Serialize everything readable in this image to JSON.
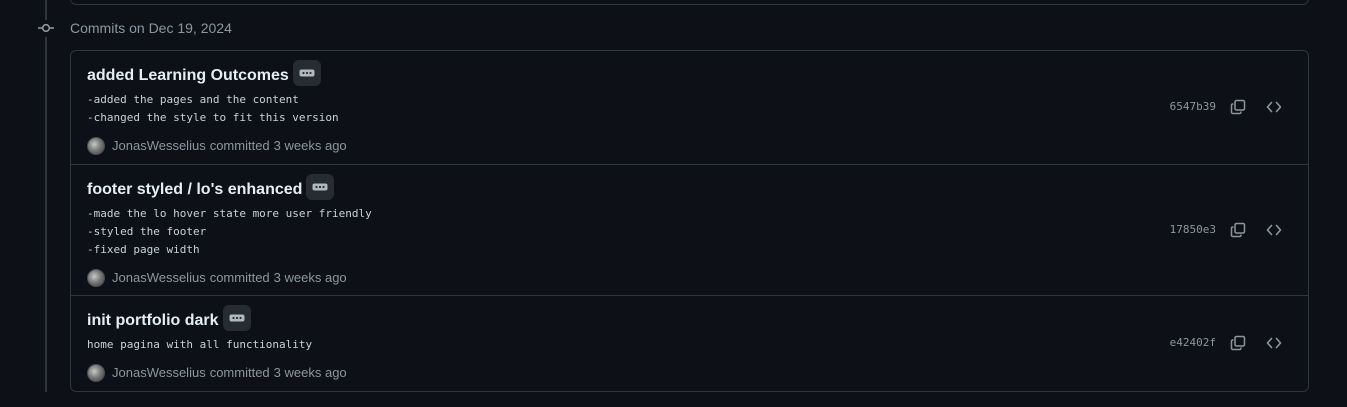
{
  "group": {
    "title": "Commits on Dec 19, 2024"
  },
  "colors": {
    "background": "#0d1117",
    "border": "#30363d",
    "text_primary": "#e6edf3",
    "text_muted": "#8d96a0",
    "button_bg": "#272c33"
  },
  "commits": [
    {
      "title": "added Learning Outcomes",
      "message_lines": [
        "-added the pages and the content",
        "-changed the style to fit this version"
      ],
      "author": "JonasWesselius",
      "action": "committed",
      "time": "3 weeks ago",
      "sha": "6547b39",
      "icons": {
        "expand": "ellipsis-icon",
        "copy": "copy-icon",
        "browse": "code-icon"
      }
    },
    {
      "title": "footer styled / lo's enhanced",
      "message_lines": [
        "-made the lo hover state more user friendly",
        "-styled the footer",
        "-fixed page width"
      ],
      "author": "JonasWesselius",
      "action": "committed",
      "time": "3 weeks ago",
      "sha": "17850e3",
      "icons": {
        "expand": "ellipsis-icon",
        "copy": "copy-icon",
        "browse": "code-icon"
      }
    },
    {
      "title": "init portfolio dark",
      "message_lines": [
        "home pagina with all functionality"
      ],
      "author": "JonasWesselius",
      "action": "committed",
      "time": "3 weeks ago",
      "sha": "e42402f",
      "icons": {
        "expand": "ellipsis-icon",
        "copy": "copy-icon",
        "browse": "code-icon"
      }
    }
  ]
}
